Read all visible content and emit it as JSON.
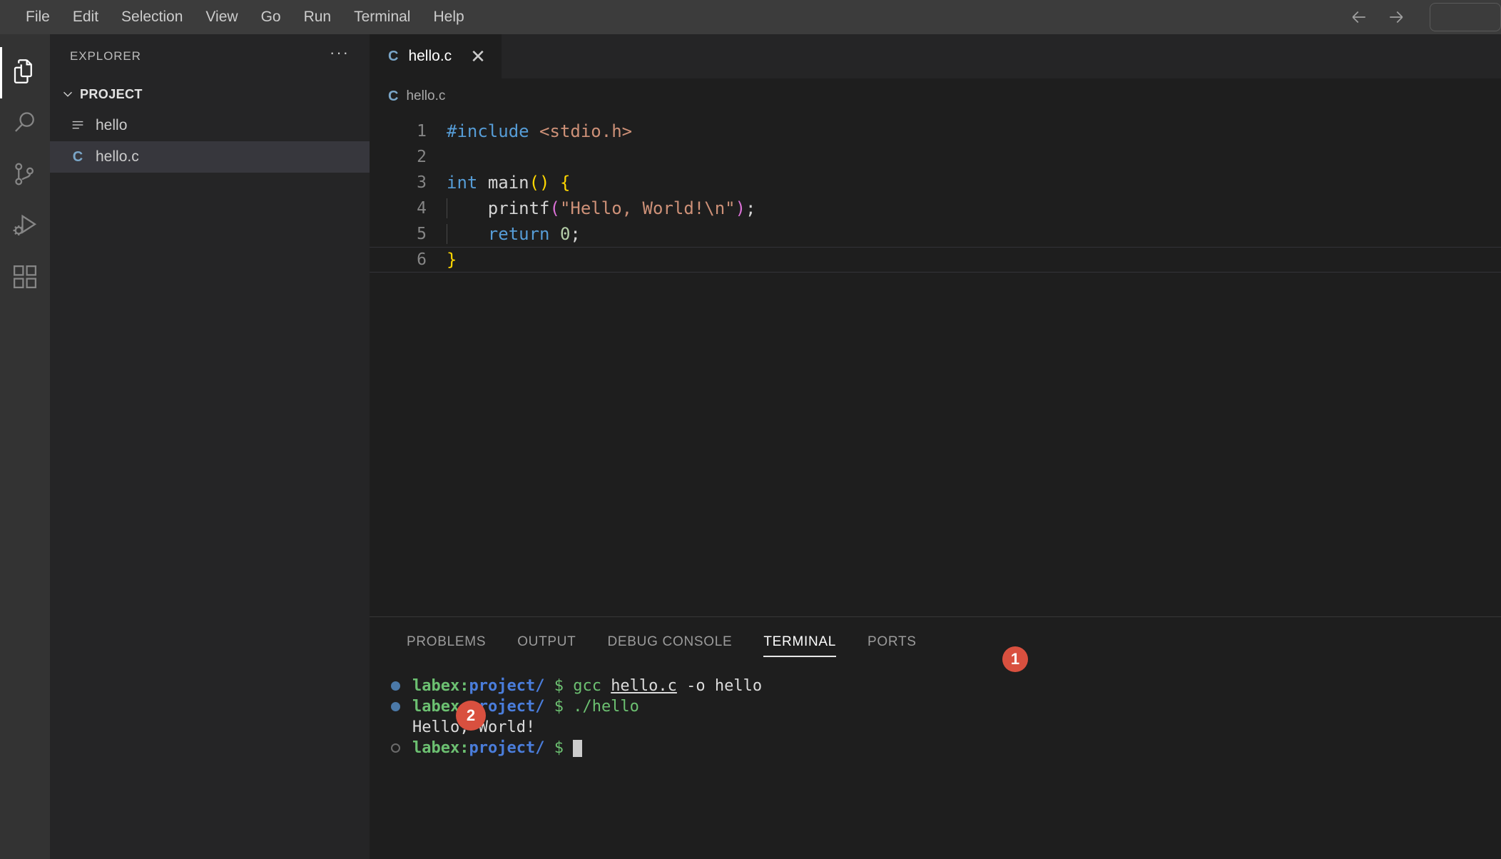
{
  "titlebar": {
    "menu": [
      {
        "label": "File"
      },
      {
        "label": "Edit"
      },
      {
        "label": "Selection"
      },
      {
        "label": "View"
      },
      {
        "label": "Go"
      },
      {
        "label": "Run"
      },
      {
        "label": "Terminal"
      },
      {
        "label": "Help"
      }
    ],
    "back_icon": "arrow-left-icon",
    "forward_icon": "arrow-right-icon",
    "command_center_value": ""
  },
  "activitybar": {
    "items": [
      {
        "name": "explorer",
        "icon": "files-icon",
        "active": true
      },
      {
        "name": "search",
        "icon": "search-icon",
        "active": false
      },
      {
        "name": "source-control",
        "icon": "git-branch-icon",
        "active": false
      },
      {
        "name": "run-debug",
        "icon": "run-debug-icon",
        "active": false
      },
      {
        "name": "extensions",
        "icon": "extensions-icon",
        "active": false
      }
    ]
  },
  "sidebar": {
    "title": "EXPLORER",
    "more_actions": "···",
    "section": {
      "label": "PROJECT",
      "expanded": true,
      "chevron": "chevron-down-icon"
    },
    "files": [
      {
        "name": "hello",
        "icon": "binary-file-icon",
        "selected": false
      },
      {
        "name": "hello.c",
        "icon": "c-file-icon",
        "selected": true
      }
    ]
  },
  "editor": {
    "tab": {
      "label": "hello.c",
      "icon": "c-file-icon",
      "close_icon": "close-icon",
      "active": true
    },
    "breadcrumb": {
      "icon": "c-file-icon",
      "label": "hello.c"
    },
    "language": "c",
    "lines": [
      {
        "num": "1",
        "indent": false,
        "cursor": false
      },
      {
        "num": "2",
        "indent": false,
        "cursor": false
      },
      {
        "num": "3",
        "indent": false,
        "cursor": false
      },
      {
        "num": "4",
        "indent": true,
        "cursor": false
      },
      {
        "num": "5",
        "indent": true,
        "cursor": false
      },
      {
        "num": "6",
        "indent": false,
        "cursor": true
      }
    ],
    "source": [
      "#include <stdio.h>",
      "",
      "int main() {",
      "    printf(\"Hello, World!\\n\");",
      "    return 0;",
      "}"
    ]
  },
  "panel": {
    "tabs": [
      {
        "label": "PROBLEMS",
        "active": false
      },
      {
        "label": "OUTPUT",
        "active": false
      },
      {
        "label": "DEBUG CONSOLE",
        "active": false
      },
      {
        "label": "TERMINAL",
        "active": true
      },
      {
        "label": "PORTS",
        "active": false
      }
    ],
    "terminal": {
      "prompt_user": "labex:",
      "prompt_path": "project/",
      "prompt_symbol": "$",
      "lines": [
        {
          "type": "command",
          "status": "done",
          "command": "gcc hello.c -o hello"
        },
        {
          "type": "command",
          "status": "done",
          "command": "./hello"
        },
        {
          "type": "output",
          "text": "Hello, World!"
        },
        {
          "type": "command",
          "status": "current",
          "command": ""
        }
      ],
      "command_1_parts": [
        {
          "text": "gcc ",
          "style": "cmd"
        },
        {
          "text": "hello.c",
          "style": "link"
        },
        {
          "text": " -o hello",
          "style": "white"
        }
      ],
      "command_2_parts": [
        {
          "text": "./hello",
          "style": "cmd"
        }
      ]
    }
  },
  "annotations": [
    {
      "id": "1",
      "label": "1"
    },
    {
      "id": "2",
      "label": "2"
    }
  ],
  "colors": {
    "titlebar_bg": "#3c3c3c",
    "activitybar_bg": "#333333",
    "sidebar_bg": "#252526",
    "editor_bg": "#1e1e1e",
    "selected_row": "#37373d",
    "accent_badge": "#d9503f",
    "keyword": "#569cd6",
    "string": "#ce9178",
    "number": "#b5cea8",
    "bracket_yellow": "#ffd700",
    "bracket_magenta": "#da70d6",
    "terminal_green": "#6cc071",
    "terminal_blue": "#4a7ddb"
  }
}
